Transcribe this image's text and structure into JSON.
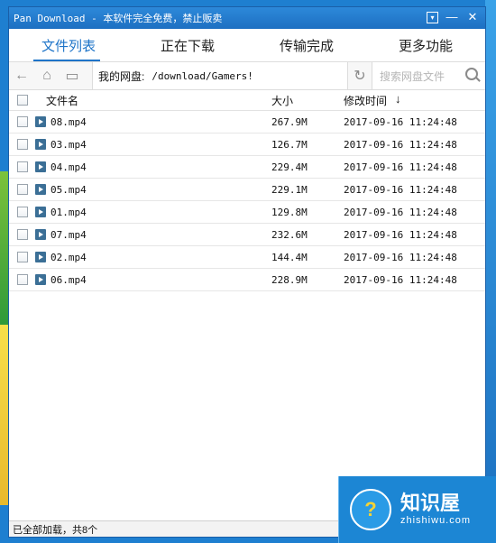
{
  "window": {
    "title": "Pan Download - 本软件完全免费，禁止贩卖",
    "controls": {
      "menu": "▾",
      "minimize": "—",
      "close": "✕"
    }
  },
  "tabs": [
    {
      "label": "文件列表",
      "active": true
    },
    {
      "label": "正在下载",
      "active": false
    },
    {
      "label": "传输完成",
      "active": false
    },
    {
      "label": "更多功能",
      "active": false
    }
  ],
  "pathbar": {
    "back_icon": "←",
    "home_icon": "⌂",
    "folder_icon": "▭",
    "path_label": "我的网盘:",
    "path_value": "/download/Gamers!",
    "refresh_icon": "↻",
    "search_placeholder": "搜索网盘文件"
  },
  "table": {
    "headers": {
      "name": "文件名",
      "size": "大小",
      "date": "修改时间",
      "sort": "↓"
    },
    "rows": [
      {
        "name": "08.mp4",
        "size": "267.9M",
        "date": "2017-09-16 11:24:48"
      },
      {
        "name": "03.mp4",
        "size": "126.7M",
        "date": "2017-09-16 11:24:48"
      },
      {
        "name": "04.mp4",
        "size": "229.4M",
        "date": "2017-09-16 11:24:48"
      },
      {
        "name": "05.mp4",
        "size": "229.1M",
        "date": "2017-09-16 11:24:48"
      },
      {
        "name": "01.mp4",
        "size": "129.8M",
        "date": "2017-09-16 11:24:48"
      },
      {
        "name": "07.mp4",
        "size": "232.6M",
        "date": "2017-09-16 11:24:48"
      },
      {
        "name": "02.mp4",
        "size": "144.4M",
        "date": "2017-09-16 11:24:48"
      },
      {
        "name": "06.mp4",
        "size": "228.9M",
        "date": "2017-09-16 11:24:48"
      }
    ]
  },
  "status": {
    "text": "已全部加载，共8个"
  },
  "watermark": {
    "main": "知识屋",
    "sub": "zhishiwu.com",
    "logo": "?"
  },
  "colors": {
    "accent": "#1e74c8",
    "titlebar": "#1d6fc2"
  }
}
